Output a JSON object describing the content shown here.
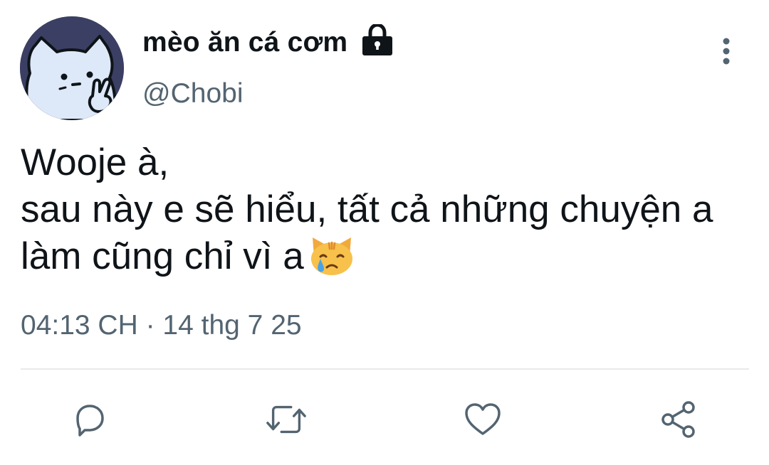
{
  "author": {
    "display_name": "mèo ăn cá cơm",
    "handle": "@Chobi",
    "protected_icon": "lock-icon",
    "avatar_icon": "white-cat-peace-sign-avatar"
  },
  "tweet": {
    "lines": [
      "Wooje à,",
      "sau này e sẽ hiểu, tất cả những chuyện a",
      "làm cũng chỉ vì a"
    ],
    "emoji": "crying-cat-face-emoji",
    "timestamp": "04:13 CH · 14 thg 7 25"
  },
  "actions": {
    "reply_icon": "reply-icon",
    "retweet_icon": "retweet-icon",
    "like_icon": "heart-icon",
    "share_icon": "share-icon",
    "more_icon": "more-vertical-icon"
  },
  "colors": {
    "text": "#0f1419",
    "secondary": "#536471",
    "divider": "#e6e9ec",
    "avatar_bg": "#3b3f63"
  }
}
